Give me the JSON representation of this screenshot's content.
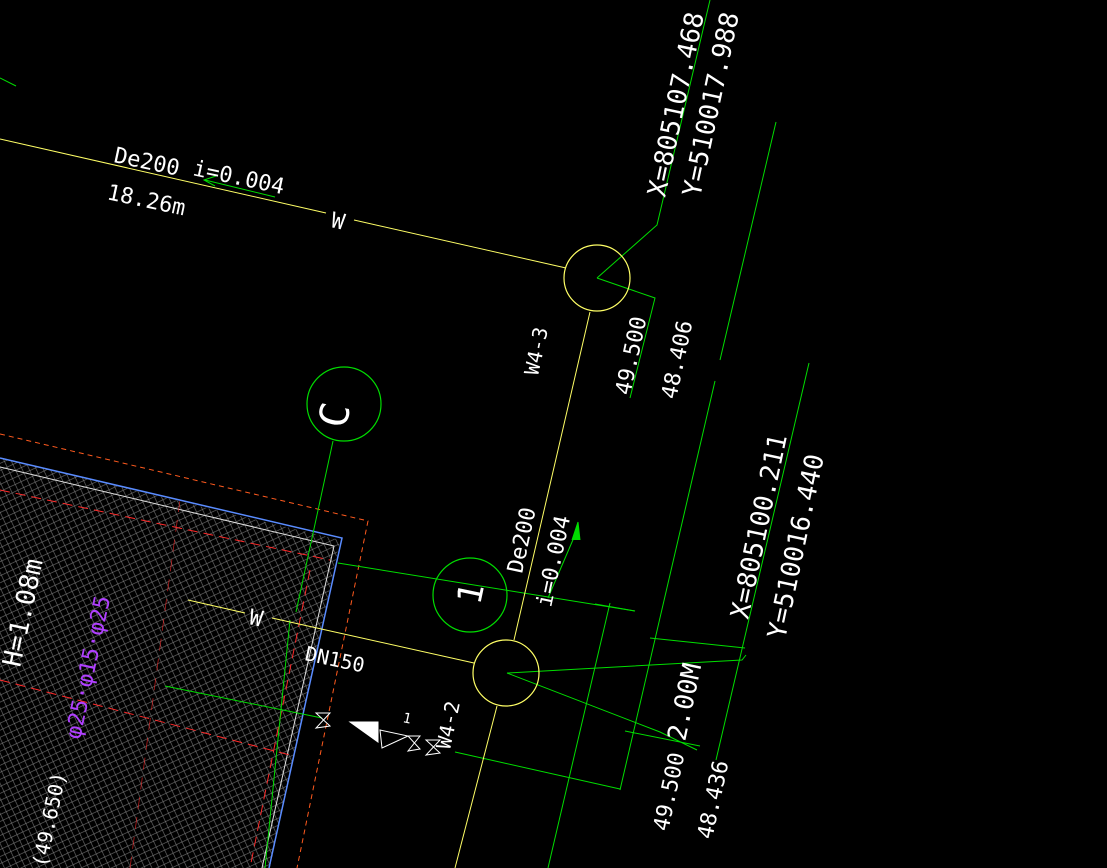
{
  "colors": {
    "background": "#000000",
    "pipe_yellow": "#ffff66",
    "leader_green": "#00dd00",
    "text_white": "#ffffff",
    "building_red": "#ff2a2a",
    "building_orange": "#ff5a1e",
    "building_blue": "#5a8cff",
    "hatch_grey": "#9a9a9a",
    "magenta": "#b040ff"
  },
  "pipe_top": {
    "size": "De200",
    "slope": "i=0.004",
    "length": "18.26m",
    "mark": "W"
  },
  "manhole_w4_3": {
    "label": "W4-3",
    "coord_x": "X=805107.468",
    "coord_y": "Y=510017.988",
    "rim_elevation": "49.500",
    "invert_elevation": "48.406"
  },
  "pipe_vertical": {
    "size": "De200",
    "slope": "i=0.004"
  },
  "manhole_w4_2": {
    "label": "W4-2",
    "coord_x": "X=805100.211",
    "coord_y": "Y=510016.440",
    "rim_elevation": "49.500",
    "invert_elevation": "48.436",
    "depth": "2.00M"
  },
  "symbols": {
    "circle_c": "C",
    "circle_1": "1"
  },
  "building_pipe": {
    "size": "DN150",
    "mark": "W",
    "valve_mark": "1"
  },
  "building": {
    "height": "H=1.08m",
    "magenta_note": "φ25·φ15·φ25",
    "elevation": "(49.650)"
  }
}
